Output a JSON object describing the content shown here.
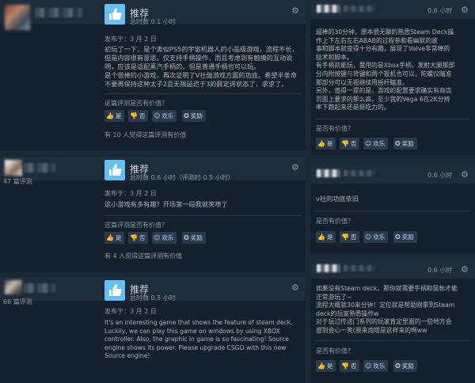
{
  "reviews": [
    {
      "recommendation": "推荐",
      "hours": "总时数 0.1 小时",
      "posted": "发布于：3 月 2 日",
      "body": [
        "初玩了一下，是个类似PS5的宇宙机器人的小品级游戏，流程不长，",
        "但是内容很有意思。仅支持手柄操作，而且考虑到有触摸的互动说",
        "明，应该是适配蒸汽手柄的，但是普通手柄也可以玩。",
        "是个很棒的小游戏，再次证明了V社做游戏方面的功底，希望半条命",
        "不要再保持这种太子2且无限延迟于3的薛定谔状态了，求求了。"
      ],
      "helpful_question": "这篇评测是否有价值？",
      "buttons": {
        "yes": "是",
        "no": "否",
        "funny": "欢乐",
        "award": "奖励"
      },
      "found_helpful": "有 10 人觉得这篇评测有价值"
    },
    {
      "review_count": "47 篇评测",
      "recommendation": "推荐",
      "hours": "总时数 0.6 小时（评测时 0.5 小时）",
      "posted": "发布于：3 月 2 日",
      "body": [
        "这小游戏有多有趣？开场第一段我就笑喷了"
      ],
      "helpful_question": "这篇评测是否有价值？",
      "buttons": {
        "yes": "是",
        "no": "否",
        "funny": "欢乐",
        "award": "奖励"
      },
      "found_helpful": "有 4 人觉得这篇评测有价值"
    },
    {
      "review_count": "66 篇评测",
      "recommendation": "推荐",
      "hours": "总时数 0.5 小时",
      "posted": "发布于：3 月 2 日",
      "body": [
        "It's an interesting game that shows the feature of steam deck.",
        "Luckily, we can play this game on windows by using XBOX",
        "controller. Also, the graphic in game is so fascinating! Source",
        "engine shows its power. Please upgrade CSGO with this new",
        "Source engine!"
      ]
    }
  ],
  "side_reviews": [
    {
      "hours": "0.6 小时",
      "body": [
        "超棒的30分钟，原本很无聊的熟悉Steam Deck操",
        "作上下左右左右ABAB的过程参和看幽默的故",
        "事和脚本就变得十分有趣，展现了Valve非常棒的",
        "技术和脚本。",
        "有手柄就能玩，我用的是Xbox手柄，发射大腿那部",
        "分内附按键与背键和两个扳机也可以，陀螺仪瞄准",
        "那部分可以无视继续用摇杆瞄准。",
        "另外，值得一提的是，游戏的配置要求确实有商店",
        "页面上要求的那么高，至少我的Vega 6在2K分辨",
        "率下跑起来还是挺吃力的。"
      ],
      "helpful_question": "是否有价值？",
      "buttons": {
        "yes": "是",
        "no": "否",
        "funny": "欢乐",
        "award": "奖励"
      }
    },
    {
      "hours": "0.6 小时",
      "body": [
        "v社的功底依旧"
      ],
      "helpful_question": "是否有价值？",
      "buttons": {
        "yes": "是",
        "no": "否",
        "funny": "欢乐",
        "award": "奖励"
      }
    },
    {
      "hours": "0.6 小时",
      "body": [
        "如果没有Steam deck，那你就需要手柄和鼠标才能",
        "正常游玩了~",
        "流程大概就30来分钟！定位就是帮助刚拿到Steam",
        "deck的玩家熟悉操作w",
        "对于玩过传送门系列的玩家肯定里面的一些地方会",
        "感到会心一笑(原来炮塔是这样来的啊ww"
      ],
      "helpful_question": "是否有价值？",
      "buttons": {
        "yes": "是",
        "no": "否",
        "funny": "欢乐",
        "award": "奖励"
      }
    }
  ],
  "icons": {
    "thumb": "thumbs-up-icon",
    "steam": "steam-logo-icon",
    "yes": "thumbs-up-small-icon",
    "no": "thumbs-down-small-icon",
    "funny": "laughing-face-icon",
    "award": "award-icon"
  },
  "colors": {
    "background": "#1b2838",
    "card": "#16202d",
    "thumb": "#66c0f4",
    "button": "#2a3a4e"
  }
}
